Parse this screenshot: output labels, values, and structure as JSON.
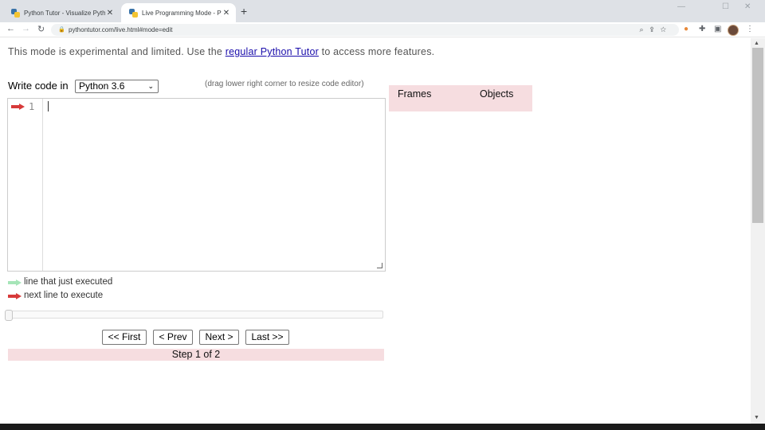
{
  "browser": {
    "tabs": [
      {
        "title": "Python Tutor - Visualize Python...",
        "active": false
      },
      {
        "title": "Live Programming Mode - Pytho...",
        "active": true
      }
    ],
    "new_tab": "+",
    "url": "pythontutor.com/live.html#mode=edit",
    "window_controls": [
      "—",
      "☐",
      "✕"
    ]
  },
  "page": {
    "note_prefix": "This mode is experimental and limited. Use the ",
    "note_link": "regular Python Tutor",
    "note_suffix": " to access more features.",
    "write_code_label": "Write code in",
    "language_selected": "Python 3.6",
    "drag_hint": "(drag lower right corner to resize code editor)",
    "editor": {
      "line_number": "1",
      "code": ""
    },
    "legend": {
      "executed": "line that just executed",
      "next": "next line to execute"
    },
    "buttons": {
      "first": "<< First",
      "prev": "< Prev",
      "next": "Next >",
      "last": "Last >>"
    },
    "step_text": "Step 1 of 2",
    "viz": {
      "frames": "Frames",
      "objects": "Objects"
    }
  },
  "colors": {
    "accent_pink": "#f6dde0",
    "next_arrow": "#d73a3a",
    "executed_arrow": "#a6e5b8",
    "link": "#1a0dab"
  }
}
